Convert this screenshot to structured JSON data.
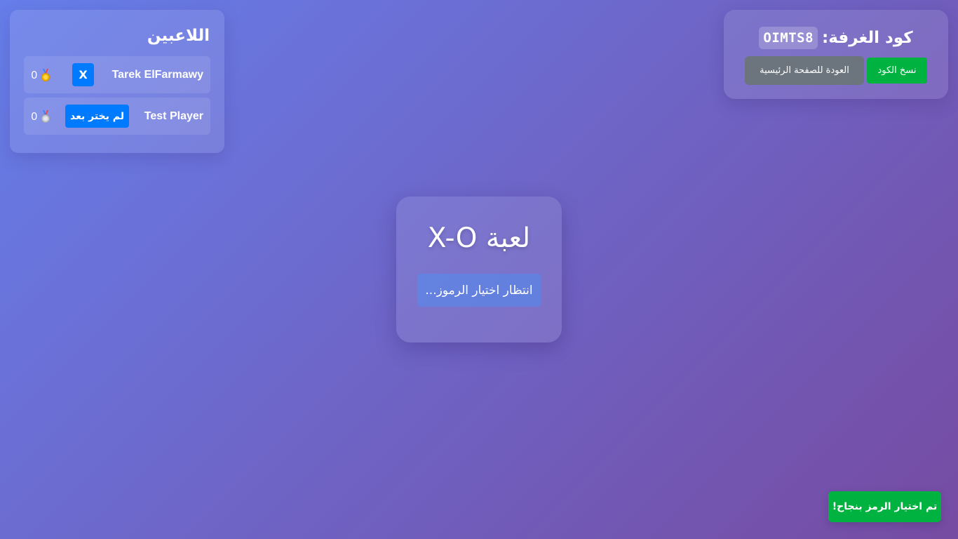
{
  "room": {
    "label": "كود الغرفة:",
    "code": "OIMTS8",
    "copy_button": "نسخ الكود",
    "home_button": "العودة للصفحة الرئيسية"
  },
  "players": {
    "title": "اللاعبين",
    "list": [
      {
        "name": "Tarek ElFarmawy",
        "symbol": "X",
        "score": "0",
        "medal_icon": "gold-medal-icon"
      },
      {
        "name": "Test Player",
        "symbol": "لم يختر بعد",
        "score": "0",
        "medal_icon": "silver-medal-icon"
      }
    ]
  },
  "game": {
    "title": "لعبة X-O",
    "status": "انتظار اختيار الرموز..."
  },
  "toast": {
    "message": "تم اختيار الرمز بنجاح!"
  },
  "colors": {
    "background_start": "#667eea",
    "background_end": "#764ba2",
    "success": "#00b341",
    "primary": "#007bff",
    "secondary": "#6c757d"
  }
}
